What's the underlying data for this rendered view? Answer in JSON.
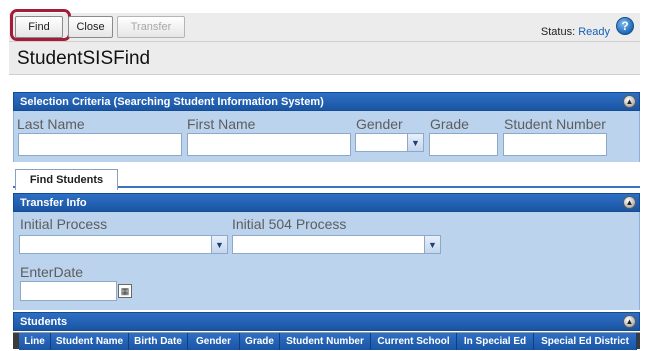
{
  "toolbar": {
    "find_label": "Find",
    "close_label": "Close",
    "transfer_label": "Transfer",
    "status_label": "Status:",
    "status_value": "Ready",
    "help_icon": "help-icon"
  },
  "page": {
    "title": "StudentSISFind"
  },
  "selection_criteria": {
    "header": "Selection Criteria (Searching Student Information System)",
    "fields": {
      "last_name": {
        "label": "Last Name",
        "value": ""
      },
      "first_name": {
        "label": "First Name",
        "value": ""
      },
      "gender": {
        "label": "Gender",
        "value": ""
      },
      "grade": {
        "label": "Grade",
        "value": ""
      },
      "student_number": {
        "label": "Student Number",
        "value": ""
      }
    }
  },
  "tabs": [
    {
      "label": "Find Students",
      "active": true
    }
  ],
  "transfer_info": {
    "header": "Transfer Info",
    "fields": {
      "initial_process": {
        "label": "Initial Process",
        "value": ""
      },
      "initial_504_process": {
        "label": "Initial 504 Process",
        "value": ""
      },
      "enter_date": {
        "label": "EnterDate",
        "value": ""
      }
    }
  },
  "students": {
    "header": "Students",
    "columns": [
      "Line",
      "Student Name",
      "Birth Date",
      "Gender",
      "Grade",
      "Student Number",
      "Current School",
      "In Special Ed",
      "Special Ed District"
    ]
  },
  "colors": {
    "header_blue": "#1f5fb2",
    "panel_bg": "#bcd3ee",
    "find_highlight": "#a31d3a"
  }
}
